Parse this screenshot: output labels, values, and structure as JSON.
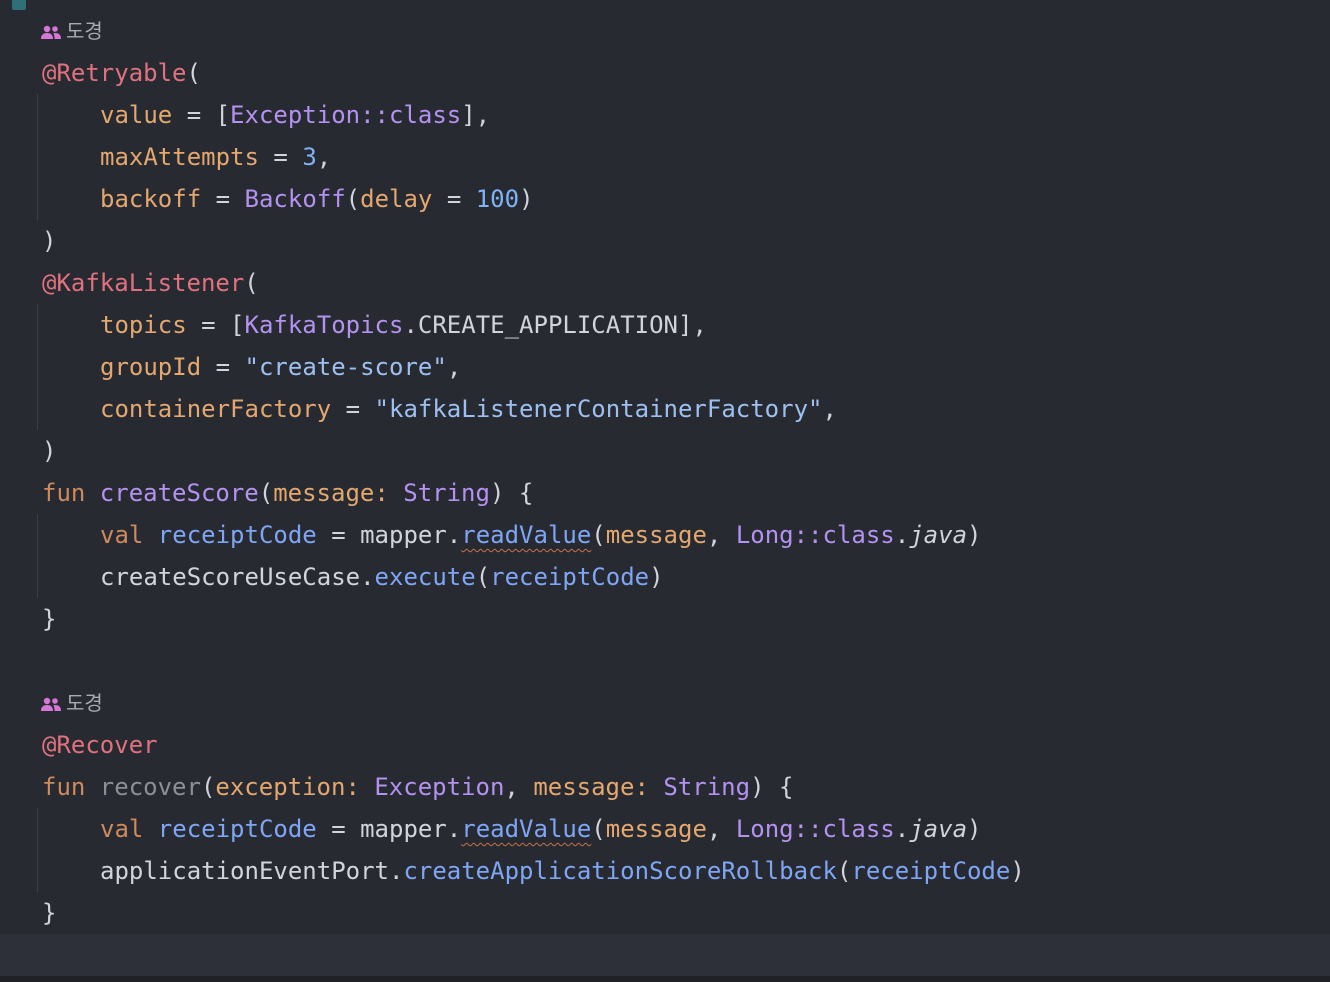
{
  "colors": {
    "background": "#272a31",
    "current_line": "#2d3038",
    "annotation": "#e0727f",
    "keyword": "#ce8a5c",
    "param": "#e3a76f",
    "type": "#b392f0",
    "function": "#b392f0",
    "function_call": "#7fa6f5",
    "number": "#7fb3f5",
    "string": "#9ec0f0",
    "plain": "#d1d4dc",
    "unused": "#8c8f96",
    "author": "#a8abb3",
    "author_icon": "#d577d6"
  },
  "author_hints": [
    {
      "icon": "people-icon",
      "name": "도경"
    },
    {
      "icon": "people-icon",
      "name": "도경"
    }
  ],
  "code_lines": [
    {
      "tokens": [
        {
          "text": "@Retryable",
          "c": "annotation"
        },
        {
          "text": "(",
          "c": "plain"
        }
      ]
    },
    {
      "indent": 1,
      "tokens": [
        {
          "text": "value",
          "c": "param"
        },
        {
          "text": " = [",
          "c": "plain"
        },
        {
          "text": "Exception::class",
          "c": "type"
        },
        {
          "text": "],",
          "c": "plain"
        }
      ]
    },
    {
      "indent": 1,
      "tokens": [
        {
          "text": "maxAttempts",
          "c": "param"
        },
        {
          "text": " = ",
          "c": "plain"
        },
        {
          "text": "3",
          "c": "number"
        },
        {
          "text": ",",
          "c": "plain"
        }
      ]
    },
    {
      "indent": 1,
      "tokens": [
        {
          "text": "backoff",
          "c": "param"
        },
        {
          "text": " = ",
          "c": "plain"
        },
        {
          "text": "Backoff",
          "c": "type"
        },
        {
          "text": "(",
          "c": "plain"
        },
        {
          "text": "delay",
          "c": "param"
        },
        {
          "text": " = ",
          "c": "plain"
        },
        {
          "text": "100",
          "c": "number"
        },
        {
          "text": ")",
          "c": "plain"
        }
      ]
    },
    {
      "tokens": [
        {
          "text": ")",
          "c": "plain"
        }
      ]
    },
    {
      "tokens": [
        {
          "text": "@KafkaListener",
          "c": "annotation"
        },
        {
          "text": "(",
          "c": "plain"
        }
      ]
    },
    {
      "indent": 1,
      "tokens": [
        {
          "text": "topics",
          "c": "param"
        },
        {
          "text": " = [",
          "c": "plain"
        },
        {
          "text": "KafkaTopics",
          "c": "type"
        },
        {
          "text": ".CREATE_APPLICATION],",
          "c": "plain"
        }
      ]
    },
    {
      "indent": 1,
      "tokens": [
        {
          "text": "groupId",
          "c": "param"
        },
        {
          "text": " = ",
          "c": "plain"
        },
        {
          "text": "\"create-score\"",
          "c": "string"
        },
        {
          "text": ",",
          "c": "plain"
        }
      ]
    },
    {
      "indent": 1,
      "tokens": [
        {
          "text": "containerFactory",
          "c": "param"
        },
        {
          "text": " = ",
          "c": "plain"
        },
        {
          "text": "\"kafkaListenerContainerFactory\"",
          "c": "string"
        },
        {
          "text": ",",
          "c": "plain"
        }
      ]
    },
    {
      "tokens": [
        {
          "text": ")",
          "c": "plain"
        }
      ]
    },
    {
      "tokens": [
        {
          "text": "fun ",
          "c": "keyword"
        },
        {
          "text": "createScore",
          "c": "function"
        },
        {
          "text": "(",
          "c": "plain"
        },
        {
          "text": "message: ",
          "c": "param"
        },
        {
          "text": "String",
          "c": "type"
        },
        {
          "text": ") {",
          "c": "plain"
        }
      ]
    },
    {
      "indent": 1,
      "tokens": [
        {
          "text": "val ",
          "c": "keyword"
        },
        {
          "text": "receiptCode",
          "c": "function_call"
        },
        {
          "text": " = mapper.",
          "c": "plain"
        },
        {
          "text": "readValue",
          "c": "function_call",
          "squiggle": true
        },
        {
          "text": "(",
          "c": "plain"
        },
        {
          "text": "message",
          "c": "param"
        },
        {
          "text": ", ",
          "c": "plain"
        },
        {
          "text": "Long::class",
          "c": "type"
        },
        {
          "text": ".",
          "c": "plain"
        },
        {
          "text": "java",
          "c": "plain",
          "italic": true
        },
        {
          "text": ")",
          "c": "plain"
        }
      ]
    },
    {
      "indent": 1,
      "tokens": [
        {
          "text": "createScoreUseCase.",
          "c": "plain"
        },
        {
          "text": "execute",
          "c": "function_call"
        },
        {
          "text": "(",
          "c": "plain"
        },
        {
          "text": "receiptCode",
          "c": "function_call"
        },
        {
          "text": ")",
          "c": "plain"
        }
      ]
    },
    {
      "tokens": [
        {
          "text": "}",
          "c": "plain"
        }
      ]
    },
    {
      "tokens": []
    },
    {
      "tokens": [
        {
          "text": "@Recover",
          "c": "annotation"
        }
      ]
    },
    {
      "tokens": [
        {
          "text": "fun ",
          "c": "keyword"
        },
        {
          "text": "recover",
          "c": "unused"
        },
        {
          "text": "(",
          "c": "plain"
        },
        {
          "text": "exception: ",
          "c": "param"
        },
        {
          "text": "Exception",
          "c": "type"
        },
        {
          "text": ", ",
          "c": "plain"
        },
        {
          "text": "message: ",
          "c": "param"
        },
        {
          "text": "String",
          "c": "type"
        },
        {
          "text": ") {",
          "c": "plain"
        }
      ]
    },
    {
      "indent": 1,
      "tokens": [
        {
          "text": "val ",
          "c": "keyword"
        },
        {
          "text": "receiptCode",
          "c": "function_call"
        },
        {
          "text": " = mapper.",
          "c": "plain"
        },
        {
          "text": "readValue",
          "c": "function_call",
          "squiggle": true
        },
        {
          "text": "(",
          "c": "plain"
        },
        {
          "text": "message",
          "c": "param"
        },
        {
          "text": ", ",
          "c": "plain"
        },
        {
          "text": "Long::class",
          "c": "type"
        },
        {
          "text": ".",
          "c": "plain"
        },
        {
          "text": "java",
          "c": "plain",
          "italic": true
        },
        {
          "text": ")",
          "c": "plain"
        }
      ]
    },
    {
      "indent": 1,
      "tokens": [
        {
          "text": "applicationEventPort.",
          "c": "plain"
        },
        {
          "text": "createApplicationScoreRollback",
          "c": "function_call"
        },
        {
          "text": "(",
          "c": "plain"
        },
        {
          "text": "receiptCode",
          "c": "function_call"
        },
        {
          "text": ")",
          "c": "plain"
        }
      ]
    },
    {
      "tokens": [
        {
          "text": "}",
          "c": "plain"
        }
      ]
    }
  ]
}
